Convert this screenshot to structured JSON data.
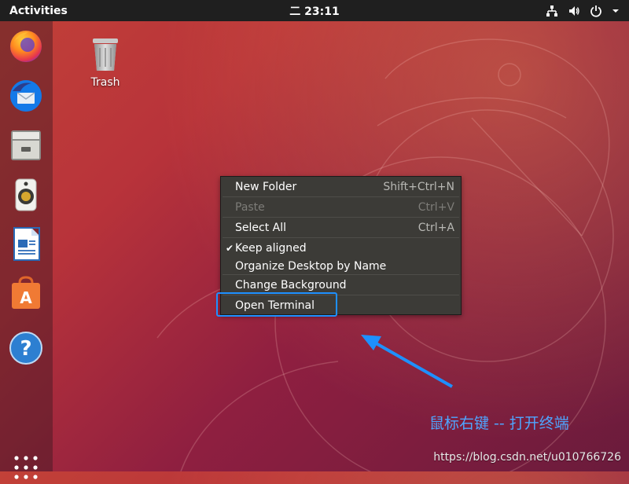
{
  "topbar": {
    "activities": "Activities",
    "clock": "二 23:11"
  },
  "tray": {
    "icons": [
      "network-icon",
      "volume-icon",
      "power-icon",
      "chevron-down-icon"
    ]
  },
  "dock": {
    "apps": [
      "firefox-icon",
      "thunderbird-icon",
      "files-icon",
      "rhythmbox-icon",
      "writer-icon",
      "software-icon",
      "help-icon"
    ]
  },
  "desktop": {
    "trash_label": "Trash"
  },
  "menu": {
    "items": [
      {
        "label": "New Folder",
        "accel": "Shift+Ctrl+N",
        "enabled": true
      },
      {
        "label": "Paste",
        "accel": "Ctrl+V",
        "enabled": false
      },
      {
        "label": "Select All",
        "accel": "Ctrl+A",
        "enabled": true
      },
      {
        "label": "Keep aligned",
        "checked": true,
        "enabled": true
      },
      {
        "label": "Organize Desktop by Name",
        "enabled": true
      },
      {
        "label": "Change Background",
        "enabled": true
      },
      {
        "label": "Open Terminal",
        "enabled": true
      }
    ],
    "check_glyph": "✔"
  },
  "annotation": {
    "text": "鼠标右键 -- 打开终端",
    "color": "#4fa5ff"
  },
  "watermark": "https://blog.csdn.net/u010766726"
}
